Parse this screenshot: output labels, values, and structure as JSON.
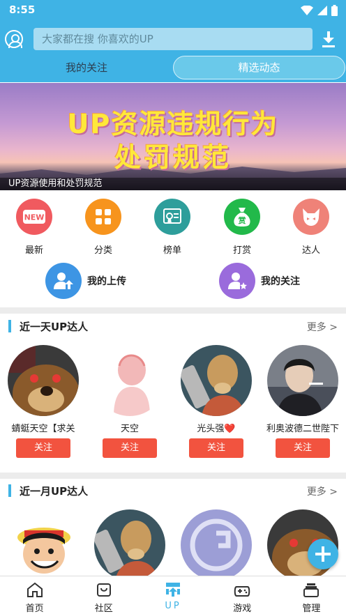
{
  "status_bar": {
    "time": "8:55"
  },
  "header": {
    "search_placeholder": "大家都在搜  你喜欢的UP",
    "tabs": [
      {
        "label": "我的关注"
      },
      {
        "label": "精选动态"
      }
    ]
  },
  "banner": {
    "title_line1": "UP资源违规行为",
    "title_line2": "处罚规范",
    "caption": "UP资源使用和处罚规范"
  },
  "categories": [
    {
      "label": "最新",
      "icon": "new-badge-icon",
      "color": "#f05a5f"
    },
    {
      "label": "分类",
      "icon": "grid-icon",
      "color": "#f7941d"
    },
    {
      "label": "榜单",
      "icon": "certificate-icon",
      "color": "#2e9e9b"
    },
    {
      "label": "打赏",
      "icon": "money-bag-icon",
      "color": "#22b94a"
    },
    {
      "label": "达人",
      "icon": "devil-face-icon",
      "color": "#ef8278"
    }
  ],
  "quick_links": [
    {
      "label": "我的上传",
      "icon": "user-upload-icon",
      "color": "#3d95e4"
    },
    {
      "label": "我的关注",
      "icon": "user-star-icon",
      "color": "#9a6bdc"
    }
  ],
  "daily_section": {
    "title": "近一天UP达人",
    "more": "更多 >",
    "uploaders": [
      {
        "name": "蜻蜓天空【求关",
        "follow": "关注"
      },
      {
        "name": "天空",
        "follow": "关注"
      },
      {
        "name": "光头强❤️",
        "follow": "关注"
      },
      {
        "name": "利奥波德二世陛下",
        "follow": "关注"
      }
    ]
  },
  "monthly_section": {
    "title": "近一月UP达人",
    "more": "更多 >"
  },
  "bottom_nav": [
    {
      "label": "首页",
      "icon": "home-icon"
    },
    {
      "label": "社区",
      "icon": "community-icon"
    },
    {
      "label": "UP",
      "icon": "up-icon",
      "active": true
    },
    {
      "label": "游戏",
      "icon": "gamepad-icon"
    },
    {
      "label": "管理",
      "icon": "manage-icon"
    }
  ],
  "colors": {
    "primary": "#3fb3e5",
    "follow_button": "#f2533f"
  }
}
